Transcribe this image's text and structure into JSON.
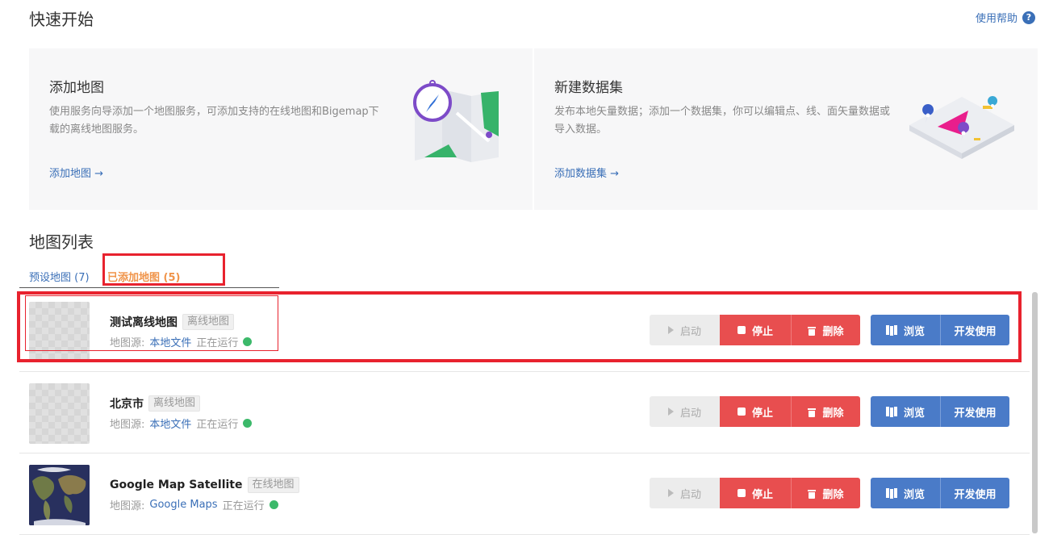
{
  "header": {
    "title": "快速开始",
    "help_label": "使用帮助",
    "help_icon": "question-circle-icon"
  },
  "quickstart": {
    "add_map": {
      "title": "添加地图",
      "desc": "使用服务向导添加一个地图服务，可添加支持的在线地图和Bigemap下载的离线地图服务。",
      "link": "添加地图 →"
    },
    "new_dataset": {
      "title": "新建数据集",
      "desc": "发布本地矢量数据；添加一个数据集，你可以编辑点、线、面矢量数据或导入数据。",
      "link": "添加数据集 →"
    }
  },
  "map_list": {
    "title": "地图列表",
    "tabs": [
      {
        "label": "预设地图 (7)"
      },
      {
        "label": "已添加地图 (5)",
        "active": true
      }
    ],
    "source_prefix": "地图源:",
    "rows": [
      {
        "name": "测试离线地图",
        "tag": "离线地图",
        "source": "本地文件",
        "status": "正在运行",
        "thumb": "placeholder"
      },
      {
        "name": "北京市",
        "tag": "离线地图",
        "source": "本地文件",
        "status": "正在运行",
        "thumb": "placeholder"
      },
      {
        "name": "Google Map Satellite",
        "tag": "在线地图",
        "source": "Google Maps",
        "status": "正在运行",
        "thumb": "satellite"
      }
    ],
    "buttons": {
      "start": "启动",
      "stop": "停止",
      "delete": "删除",
      "browse": "浏览",
      "develop": "开发使用"
    }
  },
  "colors": {
    "accent": "#3a6fb7",
    "danger": "#e84e4f",
    "primary": "#4a7bc8",
    "active_tab": "#f0944a",
    "running": "#3cb96a",
    "annotation": "#e8222e"
  }
}
